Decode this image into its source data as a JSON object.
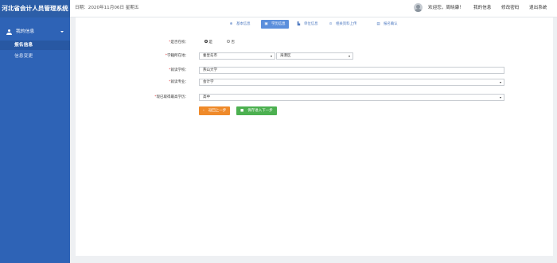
{
  "app": {
    "title": "河北省会计人员管理系统"
  },
  "header": {
    "date": "日期：2020年11月06日 星期五",
    "welcome": "欢迎您，周晓康！",
    "links": [
      "我的信息",
      "修改密码",
      "退出系统"
    ]
  },
  "sidebar": {
    "group": "我的信息",
    "items": [
      "报名信息",
      "信息变更"
    ]
  },
  "steps": [
    {
      "label": "基本信息",
      "icon": "circle-check-icon"
    },
    {
      "label": "学历信息",
      "icon": "id-card-icon"
    },
    {
      "label": "单位信息",
      "icon": "building-icon"
    },
    {
      "label": "相关资料上传",
      "icon": "upload-icon"
    },
    {
      "label": "报名确认",
      "icon": "checklist-icon"
    }
  ],
  "form": {
    "in_school": {
      "label": "是否在校：",
      "options": [
        "是",
        "否"
      ],
      "selected": "是"
    },
    "school_location": {
      "label": "学籍所在地：",
      "city": "秦皇岛市",
      "district": "海港区"
    },
    "school": {
      "label": "就读学校：",
      "value": "燕山大学"
    },
    "major": {
      "label": "就读专业：",
      "value": "会计学"
    },
    "education": {
      "label": "现已取得最高学历：",
      "value": "高中"
    }
  },
  "buttons": {
    "prev": "返回上一步",
    "next": "保存进入下一步"
  },
  "colors": {
    "sidebar": "#2e63b6",
    "accent": "#5b8fdc",
    "prev": "#ef8a2a",
    "next": "#4cb050"
  }
}
